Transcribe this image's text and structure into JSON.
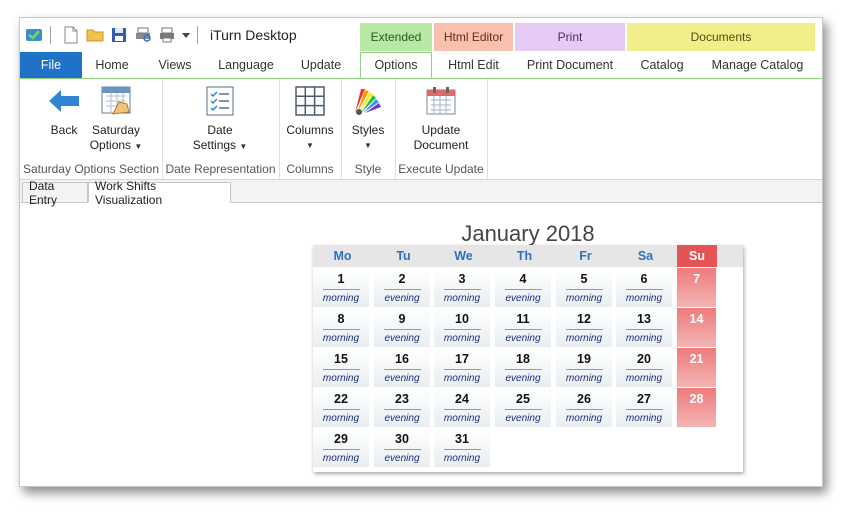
{
  "app": {
    "title": "iTurn Desktop"
  },
  "context_groups": {
    "extended": "Extended",
    "html_editor": "Html Editor",
    "print": "Print",
    "documents": "Documents"
  },
  "tabs": {
    "file": "File",
    "home": "Home",
    "views": "Views",
    "language": "Language",
    "update": "Update",
    "options": "Options",
    "html_edit": "Html Edit",
    "print_document": "Print Document",
    "catalog": "Catalog",
    "manage_catalog": "Manage Catalog"
  },
  "ribbon": {
    "back": "Back",
    "saturday_options_1": "Saturday",
    "saturday_options_2": "Options",
    "saturday_section": "Saturday Options Section",
    "date_settings_1": "Date",
    "date_settings_2": "Settings",
    "date_representation": "Date Representation",
    "columns": "Columns",
    "columns_group": "Columns",
    "styles": "Styles",
    "style_group": "Style",
    "update_document_1": "Update",
    "update_document_2": "Document",
    "execute_update": "Execute Update"
  },
  "page_tabs": {
    "data_entry": "Data Entry",
    "work_shifts": "Work Shifts Visualization"
  },
  "calendar": {
    "title": "January 2018",
    "weekdays": [
      "Mo",
      "Tu",
      "We",
      "Th",
      "Fr",
      "Sa",
      "Su"
    ],
    "days": [
      {
        "d": "1",
        "s": "morning"
      },
      {
        "d": "2",
        "s": "evening"
      },
      {
        "d": "3",
        "s": "morning"
      },
      {
        "d": "4",
        "s": "evening"
      },
      {
        "d": "5",
        "s": "morning"
      },
      {
        "d": "6",
        "s": "morning"
      },
      {
        "d": "7",
        "s": ""
      },
      {
        "d": "8",
        "s": "morning"
      },
      {
        "d": "9",
        "s": "evening"
      },
      {
        "d": "10",
        "s": "morning"
      },
      {
        "d": "11",
        "s": "evening"
      },
      {
        "d": "12",
        "s": "morning"
      },
      {
        "d": "13",
        "s": "morning"
      },
      {
        "d": "14",
        "s": ""
      },
      {
        "d": "15",
        "s": "morning"
      },
      {
        "d": "16",
        "s": "evening"
      },
      {
        "d": "17",
        "s": "morning"
      },
      {
        "d": "18",
        "s": "evening"
      },
      {
        "d": "19",
        "s": "morning"
      },
      {
        "d": "20",
        "s": "morning"
      },
      {
        "d": "21",
        "s": ""
      },
      {
        "d": "22",
        "s": "morning"
      },
      {
        "d": "23",
        "s": "evening"
      },
      {
        "d": "24",
        "s": "morning"
      },
      {
        "d": "25",
        "s": "evening"
      },
      {
        "d": "26",
        "s": "morning"
      },
      {
        "d": "27",
        "s": "morning"
      },
      {
        "d": "28",
        "s": ""
      },
      {
        "d": "29",
        "s": "morning"
      },
      {
        "d": "30",
        "s": "evening"
      },
      {
        "d": "31",
        "s": "morning"
      }
    ]
  },
  "colors": {
    "accent": "#1e73c9",
    "sunday": "#e45454",
    "weekday_header": "#2a73c2"
  }
}
